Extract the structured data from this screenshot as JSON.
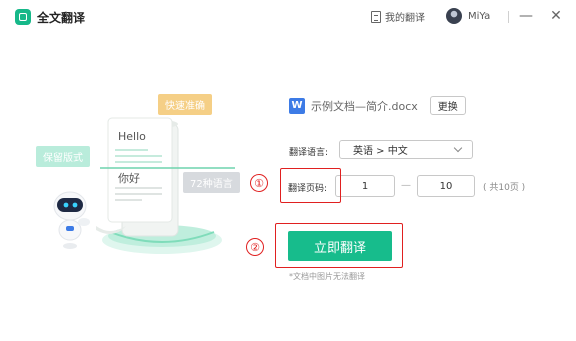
{
  "titlebar": {
    "app_title": "全文翻译",
    "my_translations": "我的翻译",
    "username": "MiYa",
    "minimize": "—",
    "close": "✕"
  },
  "illustration": {
    "tag_fast": "快速准确",
    "tag_layout": "保留版式",
    "tag_languages": "72种语言",
    "hello": "Hello",
    "nihao": "你好"
  },
  "form": {
    "file_name": "示例文档—简介.docx",
    "change_button": "更换",
    "lang_label": "翻译语言:",
    "lang_value": "英语 > 中文",
    "pages_label": "翻译页码:",
    "page_from": "1",
    "page_dash": "—",
    "page_to": "10",
    "page_total": "( 共10页 )",
    "start_button": "立即翻译",
    "note": "*文档中图片无法翻译"
  },
  "annotations": {
    "marker1": "①",
    "marker2": "②"
  },
  "colors": {
    "accent": "#17bc8c",
    "annotation_red": "#e02020",
    "word_blue": "#3d7be6"
  }
}
